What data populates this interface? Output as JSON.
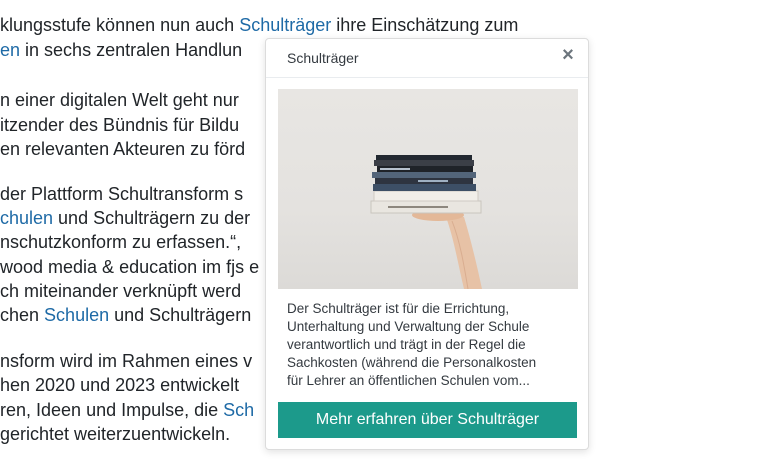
{
  "article": {
    "lines": [
      [
        {
          "text": "klungsstufe können nun auch "
        },
        {
          "text": "Schulträger",
          "link": true
        },
        {
          "text": " ihre Einschätzung zum"
        }
      ],
      [
        {
          "text": "en",
          "link": true
        },
        {
          "text": " in sechs zentralen Handlun"
        }
      ],
      [
        {
          "text": "n einer digitalen Welt geht nur"
        }
      ],
      [
        {
          "text": "itzender des Bündnis für Bildu"
        }
      ],
      [
        {
          "text": "en relevanten Akteuren zu förd"
        }
      ],
      [
        {
          "text": "der Plattform Schultransform s"
        }
      ],
      [
        {
          "text": "chulen",
          "link": true
        },
        {
          "text": " und Schulträgern zu der"
        }
      ],
      [
        {
          "text": "nschutzkonform zu erfassen.“,"
        }
      ],
      [
        {
          "text": "wood media & education im fjs e"
        }
      ],
      [
        {
          "text": "ch miteinander verknüpft werd"
        }
      ],
      [
        {
          "text": "chen "
        },
        {
          "text": "Schulen",
          "link": true
        },
        {
          "text": " und Schulträgern"
        }
      ],
      [
        {
          "text": "nsform wird im Rahmen eines v"
        }
      ],
      [
        {
          "text": "hen 2020 und 2023 entwickelt"
        }
      ],
      [
        {
          "text": "ren, Ideen und Impulse, die "
        },
        {
          "text": "Sch",
          "link": true
        }
      ],
      [
        {
          "text": "gerichtet weiterzuentwickeln."
        }
      ]
    ]
  },
  "popover": {
    "title": "Schulträger",
    "close_symbol": "×",
    "image_icon": "books-in-hand-image",
    "description_lines": [
      "Der Schulträger ist für die Errichtung,",
      "Unterhaltung und Verwaltung der Schule",
      "verantwortlich und trägt in der Regel die",
      "Sachkosten (während die Personalkosten",
      "für Lehrer an öffentlichen Schulen vom..."
    ],
    "button_label": "Mehr erfahren über Schulträger"
  },
  "colors": {
    "link": "#1e6aa6",
    "button": "#1c9a8b",
    "text": "#212529"
  }
}
